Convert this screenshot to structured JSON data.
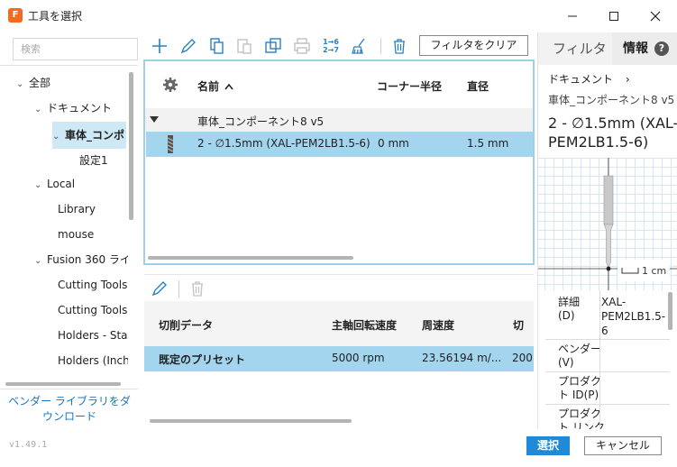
{
  "window": {
    "title": "工具を選択",
    "app_icon_letter": "F"
  },
  "tree": {
    "search_placeholder": "検索",
    "items": [
      {
        "label": "全部",
        "arrow": "⌄"
      },
      {
        "label": "ドキュメント",
        "arrow": "⌄"
      },
      {
        "label": "車体_コンポ",
        "arrow": "⌄"
      },
      {
        "label": "設定1",
        "arrow": ""
      },
      {
        "label": "Local",
        "arrow": "⌄"
      },
      {
        "label": "Library",
        "arrow": ""
      },
      {
        "label": "mouse",
        "arrow": ""
      },
      {
        "label": "Fusion 360 ライ",
        "arrow": "⌄"
      },
      {
        "label": "Cutting Tools",
        "arrow": ""
      },
      {
        "label": "Cutting Tools",
        "arrow": ""
      },
      {
        "label": "Holders - Sta",
        "arrow": ""
      },
      {
        "label": "Holders (Inch",
        "arrow": ""
      }
    ],
    "vendor_link": "ベンダー ライブラリをダウンロード",
    "version": "v1.49.1"
  },
  "toolbar": {
    "filter_clear_label": "フィルタをクリア",
    "renumber_label_top": "1→6",
    "renumber_label_bottom": "2→7"
  },
  "tool_table": {
    "headers": {
      "name": "名前",
      "corner": "コーナー半径",
      "diameter": "直径"
    },
    "group": "車体_コンポーネント8 v5",
    "row": {
      "name": "2 - ∅1.5mm (XAL-PEM2LB1.5-6)",
      "corner": "0 mm",
      "diameter": "1.5 mm"
    }
  },
  "preset_table": {
    "headers": {
      "data": "切削データ",
      "spindle": "主軸回転速度",
      "surface": "周速度",
      "feed": "切"
    },
    "row": {
      "data": "既定のプリセット",
      "spindle": "5000 rpm",
      "surface": "23.56194 m/...",
      "feed": "200"
    }
  },
  "info_panel": {
    "tab_filter": "フィルタ",
    "tab_info": "情報",
    "breadcrumb": "ドキュメント",
    "breadcrumb_arrow": "›",
    "subtitle": "車体_コンポーネント8 v5",
    "title": "2 - ∅1.5mm (XAL-PEM2LB1.5-6)",
    "scale": "1 cm",
    "details": [
      {
        "label": "詳細 (D)",
        "value": "XAL-PEM2LB1.5-6"
      },
      {
        "label": "ベンダー (V)",
        "value": ""
      },
      {
        "label": "プロダクト ID(P)",
        "value": ""
      },
      {
        "label": "プロダクト リンク",
        "value": ""
      }
    ]
  },
  "buttons": {
    "select": "選択",
    "cancel": "キャンセル"
  },
  "colors": {
    "selection": "#a3d5ef",
    "accent": "#1e8ad8",
    "icon_blue": "#2b7fc4",
    "app_orange": "#f26b21"
  }
}
